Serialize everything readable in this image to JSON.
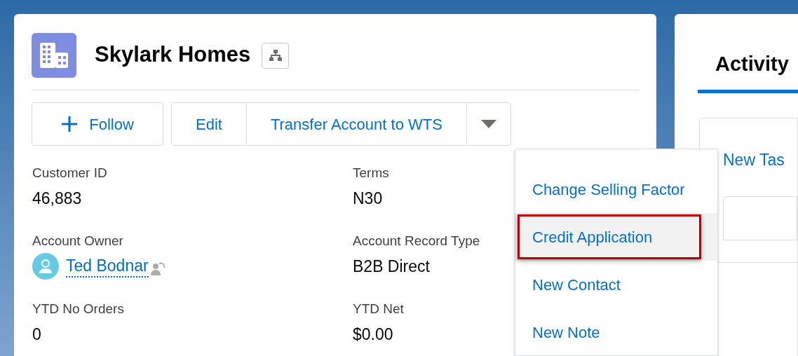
{
  "record": {
    "title": "Skylark Homes"
  },
  "actions": [
    {
      "label": "Follow",
      "kind": "follow"
    },
    {
      "label": "Edit",
      "kind": "group"
    },
    {
      "label": "Transfer Account to WTS",
      "kind": "group"
    },
    {
      "kind": "menu"
    }
  ],
  "fields": [
    {
      "label": "Customer ID",
      "value": "46,883",
      "kind": "text"
    },
    {
      "label": "Terms",
      "value": "N30",
      "kind": "text"
    },
    {
      "label": "Account Owner",
      "value": "Ted Bodnar",
      "kind": "user"
    },
    {
      "label": "Account Record Type",
      "value": "B2B Direct",
      "kind": "text"
    },
    {
      "label": "YTD No Orders",
      "value": "0",
      "kind": "text"
    },
    {
      "label": "YTD Net",
      "value": "$0.00",
      "kind": "text"
    }
  ],
  "menu": [
    {
      "label": "Change Selling Factor",
      "selected": false,
      "annotated": false
    },
    {
      "label": "Credit Application",
      "selected": true,
      "annotated": true
    },
    {
      "label": "New Contact",
      "selected": false,
      "annotated": false
    },
    {
      "label": "New Note",
      "selected": false,
      "annotated": false
    }
  ],
  "activity": {
    "tab": "Activity",
    "action": "New Tas"
  }
}
